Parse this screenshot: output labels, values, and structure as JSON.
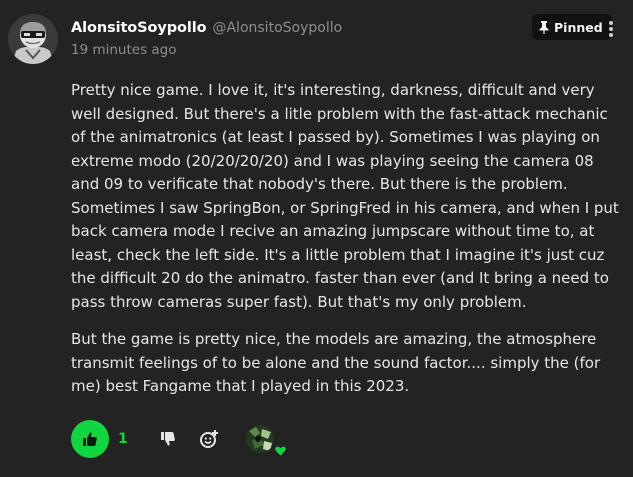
{
  "comment": {
    "author": {
      "username": "AlonsitoSoypollo",
      "handle": "@AlonsitoSoypollo",
      "avatar_icon": "masked-character-avatar"
    },
    "timestamp": "19 minutes ago",
    "pinned_label": "Pinned",
    "paragraphs": [
      "Pretty nice game. I love it, it's interesting, darkness, difficult and very well designed. But there's a litle problem with the fast-attack mechanic of the animatronics (at least I passed by). Sometimes I was playing on extreme modo (20/20/20/20) and I was playing seeing the camera 08 and 09 to verificate that nobody's there. But there is the problem. Sometimes I saw SpringBon, or SpringFred in his camera, and when I put back camera mode I recive an amazing jumpscare without time to, at least, check  the left side. It's a little problem that I imagine it's just cuz the difficult 20 do the animatro. faster than ever (and It bring a need to pass throw cameras super fast). But that's my only problem.",
      "But the game is pretty nice, the models are amazing, the atmosphere transmit feelings of to be alone and the sound factor.... simply the (for me) best Fangame that I played in this 2023."
    ],
    "reactions": {
      "like_count": "1",
      "like_icon": "thumbs-up-icon",
      "dislike_icon": "thumbs-down-icon",
      "add_reaction_icon": "add-emoji-icon",
      "creator_heart_icon": "heart-icon"
    }
  },
  "colors": {
    "background": "#232323",
    "accent_green": "#12d63f",
    "muted_text": "#8e8e8e"
  }
}
